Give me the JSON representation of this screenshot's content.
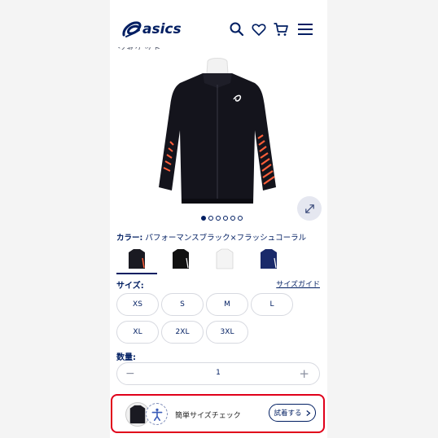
{
  "header": {
    "logo_text": "asics",
    "icons": [
      "search-icon",
      "heart-icon",
      "cart-icon",
      "menu-icon"
    ]
  },
  "product": {
    "partial_title": "ジャケット",
    "image_count": 6,
    "active_image_index": 0
  },
  "color": {
    "label": "カラー:",
    "value": "パフォーマンスブラック×フラッシュコーラル",
    "swatches": [
      {
        "name": "パフォーマンスブラック×フラッシュコーラル",
        "hex": "#1a1a22",
        "accent": "#ff5f3a",
        "selected": true
      },
      {
        "name": "black",
        "hex": "#111111",
        "accent": "#ffffff",
        "selected": false
      },
      {
        "name": "white",
        "hex": "#f4f4f4",
        "accent": "#c0c0c0",
        "selected": false
      },
      {
        "name": "navy",
        "hex": "#1a2a6a",
        "accent": "#ffffff",
        "selected": false
      }
    ]
  },
  "size": {
    "label": "サイズ:",
    "guide_label": "サイズガイド",
    "options": [
      "XS",
      "S",
      "M",
      "L",
      "XL",
      "2XL",
      "3XL"
    ]
  },
  "quantity": {
    "label": "数量:",
    "value": "1",
    "minus": "−",
    "plus": "+"
  },
  "fit_check": {
    "label": "簡単サイズチェック",
    "button_label": "試着する",
    "button_icon": "chevron-right-icon"
  },
  "colors": {
    "brand": "#001e62",
    "highlight": "#e0001a"
  }
}
